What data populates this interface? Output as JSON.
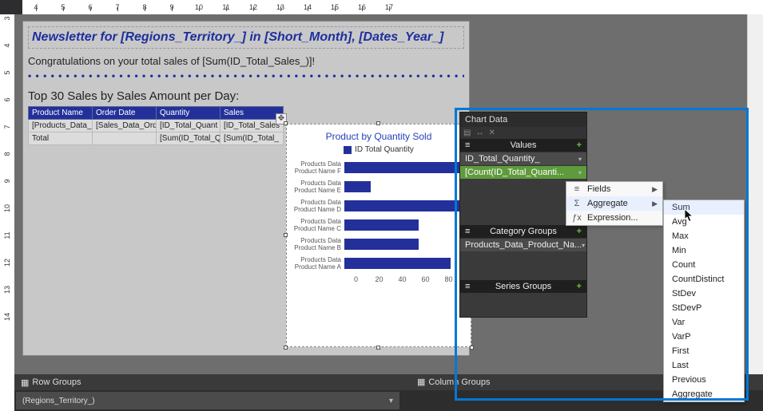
{
  "ruler_start": 4,
  "ruler_end": 17,
  "vruler_start": 3,
  "vruler_end": 14,
  "report": {
    "title": "Newsletter for [Regions_Territory_] in [Short_Month], [Dates_Year_]",
    "congrats": "Congratulations on your total sales of [Sum(ID_Total_Sales_)]!",
    "top30": "Top 30 Sales by Sales Amount per Day:",
    "table": {
      "headers": [
        "Product Name",
        "Order Date",
        "Quantity",
        "Sales"
      ],
      "row_data": [
        "[Products_Data_",
        "[Sales_Data_Ord",
        "[ID_Total_Quant",
        "[ID_Total_Sales"
      ],
      "row_total": [
        "Total",
        "",
        "[Sum(ID_Total_Q",
        "[Sum(ID_Total_"
      ]
    }
  },
  "chart": {
    "title": "Product by Quantity Sold",
    "legend": "ID Total Quantity"
  },
  "chart_data": {
    "type": "bar",
    "orientation": "horizontal",
    "title": "Product by Quantity Sold",
    "legend": [
      "ID Total Quantity"
    ],
    "categories": [
      "Products Data Product Name F",
      "Products Data Product Name E",
      "Products Data Product Name D",
      "Products Data Product Name C",
      "Products Data Product Name B",
      "Products Data Product Name A"
    ],
    "values": [
      80,
      18,
      80,
      50,
      50,
      72
    ],
    "xlim": [
      0,
      80
    ],
    "xticks": [
      0,
      20,
      40,
      60,
      80
    ]
  },
  "chartdata_panel": {
    "title": "Chart Data",
    "values_header": "Values",
    "value_field": "ID_Total_Quantity_",
    "value_expr": "[Count(ID_Total_Quanti...",
    "catgroups_header": "Category Groups",
    "catgroup_field": "Products_Data_Product_Na...",
    "seriesgroups_header": "Series Groups"
  },
  "context_menu": {
    "items": [
      {
        "icon": "≡",
        "label": "Fields"
      },
      {
        "icon": "Σ",
        "label": "Aggregate"
      },
      {
        "icon": "ƒx",
        "label": "Expression..."
      }
    ]
  },
  "aggregate_submenu": [
    "Sum",
    "Avg",
    "Max",
    "Min",
    "Count",
    "CountDistinct",
    "StDev",
    "StDevP",
    "Var",
    "VarP",
    "First",
    "Last",
    "Previous",
    "Aggregate"
  ],
  "bottom": {
    "row_groups": "Row Groups",
    "column_groups": "Column Groups",
    "region_chip": "(Regions_Territory_)"
  }
}
